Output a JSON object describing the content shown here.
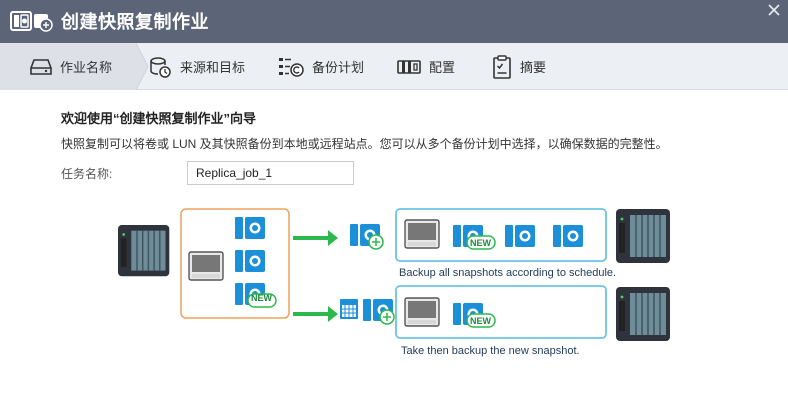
{
  "window": {
    "title": "创建快照复制作业",
    "close_icon": "close-icon",
    "app_icon": "snapshot-replica-icon"
  },
  "steps": [
    {
      "label": "作业名称",
      "icon": "drive-icon",
      "active": true
    },
    {
      "label": "来源和目标",
      "icon": "source-target-icon",
      "active": false
    },
    {
      "label": "备份计划",
      "icon": "schedule-icon",
      "active": false
    },
    {
      "label": "配置",
      "icon": "config-icon",
      "active": false
    },
    {
      "label": "摘要",
      "icon": "summary-icon",
      "active": false
    }
  ],
  "main": {
    "heading": "欢迎使用“创建快照复制作业”向导",
    "description": "快照复制可以将卷或 LUN 及其快照备份到本地或远程站点。您可以从多个备份计划中选择，以确保数据的完整性。",
    "task_name_label": "任务名称:",
    "task_name_value": "Replica_job_1"
  },
  "diagram": {
    "new_badge": "NEW",
    "caption_top": "Backup all snapshots according to schedule.",
    "caption_bottom": "Take then backup the new snapshot."
  },
  "colors": {
    "titlebar": "#5c6478",
    "accent_blue": "#1b8fd8",
    "orange": "#f0a05c",
    "green": "#2db84d",
    "frame": "#6cc3e6"
  }
}
